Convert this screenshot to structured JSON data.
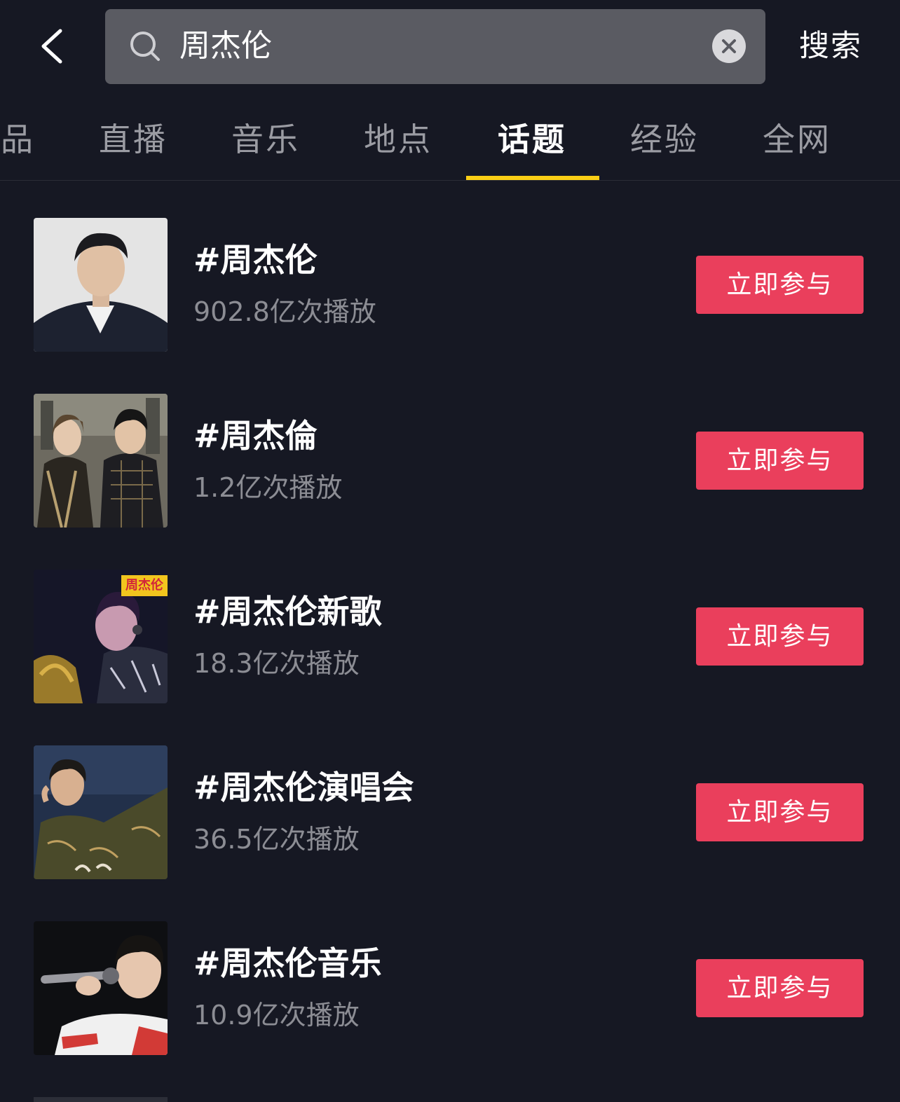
{
  "search": {
    "query": "周杰伦",
    "submit_label": "搜索"
  },
  "tabs": [
    {
      "label": "品"
    },
    {
      "label": "直播"
    },
    {
      "label": "音乐"
    },
    {
      "label": "地点"
    },
    {
      "label": "话题",
      "active": true
    },
    {
      "label": "经验"
    },
    {
      "label": "全网"
    }
  ],
  "topics": [
    {
      "title": "#周杰伦",
      "plays": "902.8亿次播放",
      "join_label": "立即参与"
    },
    {
      "title": "#周杰倫",
      "plays": "1.2亿次播放",
      "join_label": "立即参与"
    },
    {
      "title": "#周杰伦新歌",
      "plays": "18.3亿次播放",
      "join_label": "立即参与",
      "thumb_text": "周杰伦"
    },
    {
      "title": "#周杰伦演唱会",
      "plays": "36.5亿次播放",
      "join_label": "立即参与"
    },
    {
      "title": "#周杰伦音乐",
      "plays": "10.9亿次播放",
      "join_label": "立即参与"
    }
  ],
  "colors": {
    "background": "#161823",
    "search_box": "#5a5b62",
    "accent_underline": "#face15",
    "join_button": "#ea3f5c",
    "muted_text": "#8c8d94"
  }
}
